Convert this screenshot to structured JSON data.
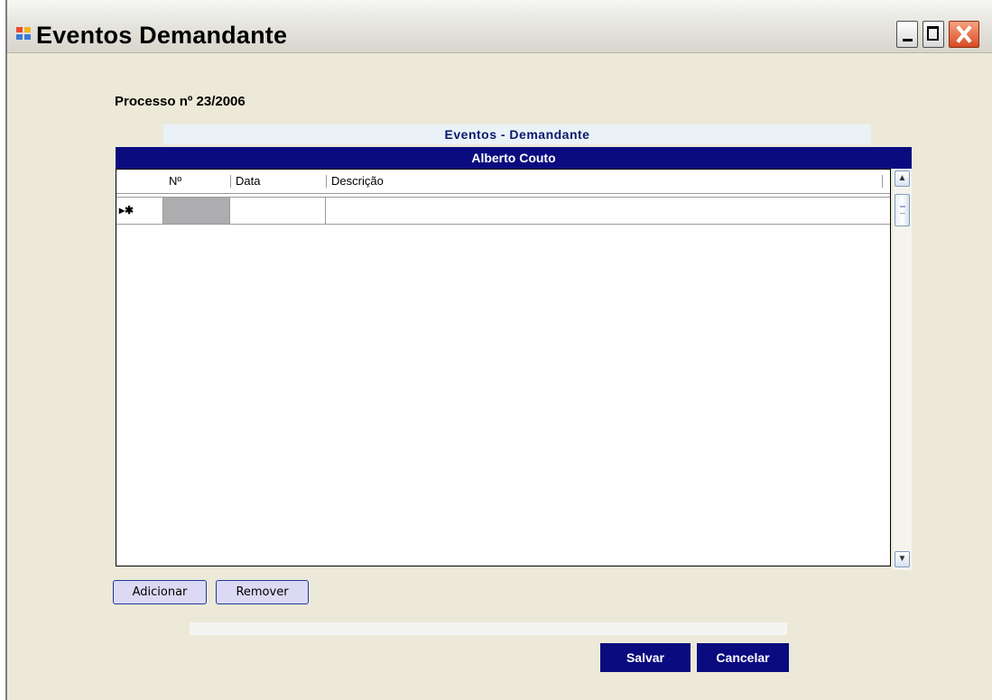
{
  "window": {
    "title": "Eventos Demandante"
  },
  "form": {
    "process_label": "Processo nº 23/2006",
    "section_header": "Eventos  - Demandante",
    "grid_title": "Alberto Couto"
  },
  "grid": {
    "columns": [
      "Nº",
      "Data",
      "Descrição"
    ],
    "new_row_marker": "▸✱",
    "rows": []
  },
  "buttons": {
    "add": "Adicionar",
    "remove": "Remover",
    "save": "Salvar",
    "cancel": "Cancelar"
  },
  "colors": {
    "accent": "#0b0b80",
    "header_text": "#0a1a6c",
    "button_light": "#dcd9f4"
  }
}
